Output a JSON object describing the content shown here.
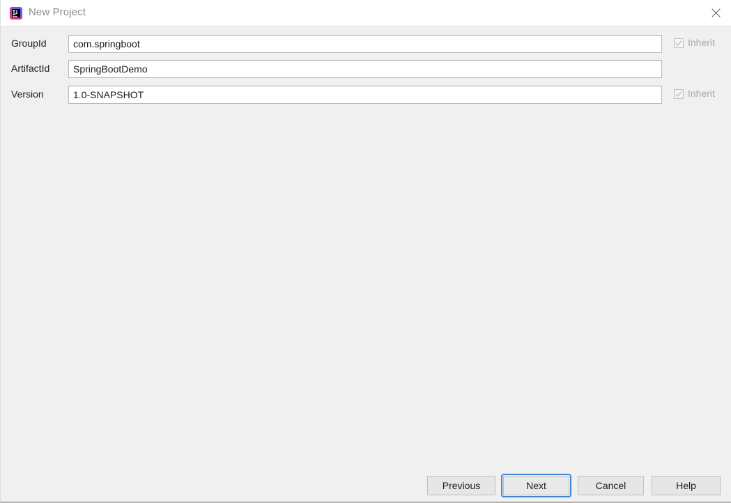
{
  "window": {
    "title": "New Project",
    "icon": "intellij-idea-icon",
    "close_icon": "close-icon",
    "background_color": "#f0f0f0",
    "titlebar_color": "#ffffff",
    "title_color": "#8a8a8a"
  },
  "form": {
    "rows": [
      {
        "label": "GroupId",
        "value": "com.springboot",
        "placeholder": "",
        "inherit": {
          "visible": true,
          "label": "Inherit",
          "checked": true,
          "disabled": true
        }
      },
      {
        "label": "ArtifactId",
        "value": "SpringBootDemo",
        "placeholder": "",
        "inherit": {
          "visible": false,
          "label": "",
          "checked": false,
          "disabled": false
        }
      },
      {
        "label": "Version",
        "value": "1.0-SNAPSHOT",
        "placeholder": "",
        "inherit": {
          "visible": true,
          "label": "Inherit",
          "checked": true,
          "disabled": true
        }
      }
    ]
  },
  "buttons": {
    "previous": "Previous",
    "next": "Next",
    "cancel": "Cancel",
    "help": "Help",
    "focused": "next",
    "focus_ring_color": "#3f87d4"
  }
}
